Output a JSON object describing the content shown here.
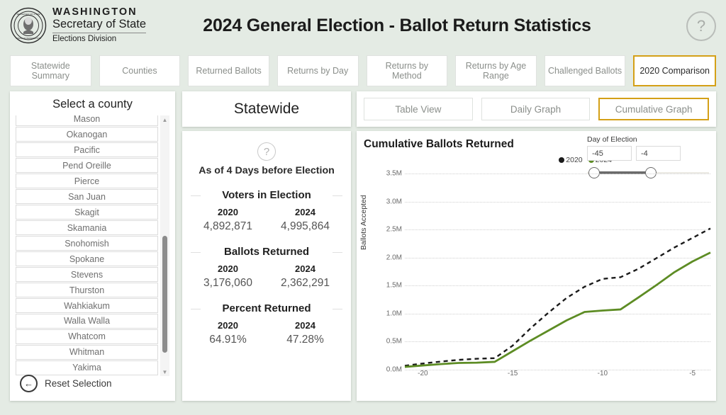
{
  "header": {
    "logo": {
      "line1": "WASHINGTON",
      "line2": "Secretary of State",
      "line3": "Elections Division",
      "seal_icon": "state-seal-icon"
    },
    "title": "2024 General Election - Ballot Return Statistics",
    "help_icon": "question-mark-icon"
  },
  "tabs": [
    {
      "label": "Statewide Summary",
      "active": false
    },
    {
      "label": "Counties",
      "active": false
    },
    {
      "label": "Returned Ballots",
      "active": false
    },
    {
      "label": "Returns by Day",
      "active": false
    },
    {
      "label": "Returns by Method",
      "active": false
    },
    {
      "label": "Returns by Age Range",
      "active": false
    },
    {
      "label": "Challenged Ballots",
      "active": false
    },
    {
      "label": "2020 Comparison",
      "active": true
    }
  ],
  "county_selector": {
    "title": "Select a county",
    "counties": [
      "Mason",
      "Okanogan",
      "Pacific",
      "Pend Oreille",
      "Pierce",
      "San Juan",
      "Skagit",
      "Skamania",
      "Snohomish",
      "Spokane",
      "Stevens",
      "Thurston",
      "Wahkiakum",
      "Walla Walla",
      "Whatcom",
      "Whitman",
      "Yakima"
    ],
    "reset_label": "Reset Selection",
    "reset_icon": "back-arrow-circle-icon",
    "scroll_up_icon": "scroll-up-arrow-icon",
    "scroll_down_icon": "scroll-down-arrow-icon"
  },
  "statewide": {
    "heading": "Statewide",
    "help_icon": "question-mark-icon",
    "as_of": "As of 4 Days before Election",
    "metrics": [
      {
        "title": "Voters in Election",
        "year_a": "2020",
        "value_a": "4,892,871",
        "year_b": "2024",
        "value_b": "4,995,864"
      },
      {
        "title": "Ballots Returned",
        "year_a": "2020",
        "value_a": "3,176,060",
        "year_b": "2024",
        "value_b": "2,362,291"
      },
      {
        "title": "Percent Returned",
        "year_a": "2020",
        "value_a": "64.91%",
        "year_b": "2024",
        "value_b": "47.28%"
      }
    ]
  },
  "view_buttons": [
    {
      "label": "Table View",
      "active": false
    },
    {
      "label": "Daily Graph",
      "active": false
    },
    {
      "label": "Cumulative Graph",
      "active": true
    }
  ],
  "slider": {
    "label": "Day of Election",
    "min_value": "-45",
    "max_value": "-4"
  },
  "colors": {
    "accent_gold": "#d4a017",
    "series_2024_green": "#5d8c24",
    "series_2020_black": "#1a1a1a",
    "page_background": "#e4ebe4"
  },
  "chart_data": {
    "type": "line",
    "title": "Cumulative Ballots Returned",
    "xlabel": "",
    "ylabel": "Ballots Accepted",
    "xlim": [
      -21,
      -4
    ],
    "ylim": [
      0,
      3500000
    ],
    "xticks": [
      -20,
      -15,
      -10,
      -5
    ],
    "ytick_labels": [
      "0.0M",
      "0.5M",
      "1.0M",
      "1.5M",
      "2.0M",
      "2.5M",
      "3.0M",
      "3.5M"
    ],
    "ytick_values": [
      0,
      500000,
      1000000,
      1500000,
      2000000,
      2500000,
      3000000,
      3500000
    ],
    "grid": true,
    "legend_position": "top-right",
    "x": [
      -21,
      -20,
      -19,
      -18,
      -17,
      -16,
      -15,
      -14,
      -13,
      -12,
      -11,
      -10,
      -9,
      -8,
      -7,
      -6,
      -5,
      -4
    ],
    "series": [
      {
        "name": "2020",
        "color": "#1a1a1a",
        "style": "dashed",
        "values": [
          70000,
          110000,
          145000,
          175000,
          195000,
          205000,
          430000,
          740000,
          1020000,
          1280000,
          1480000,
          1620000,
          1650000,
          1800000,
          1990000,
          2180000,
          2350000,
          2520000
        ]
      },
      {
        "name": "2024",
        "color": "#5d8c24",
        "style": "solid",
        "values": [
          50000,
          75000,
          100000,
          120000,
          125000,
          140000,
          330000,
          520000,
          700000,
          880000,
          1030000,
          1055000,
          1075000,
          1290000,
          1510000,
          1740000,
          1930000,
          2090000
        ]
      }
    ]
  }
}
